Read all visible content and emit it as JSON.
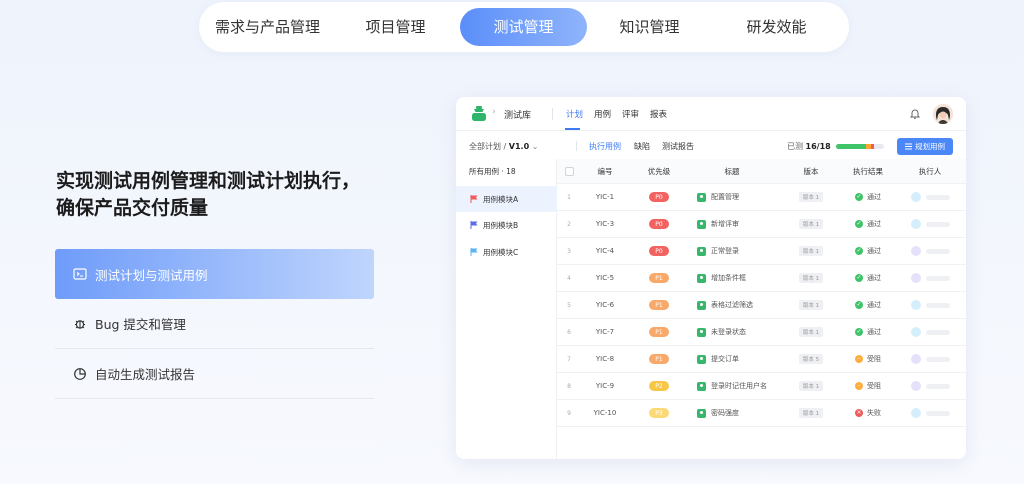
{
  "topnav": {
    "tabs": [
      {
        "label": "需求与产品管理",
        "active": false
      },
      {
        "label": "项目管理",
        "active": false
      },
      {
        "label": "测试管理",
        "active": true
      },
      {
        "label": "知识管理",
        "active": false
      },
      {
        "label": "研发效能",
        "active": false
      }
    ]
  },
  "hero": {
    "line1": "实现测试用例管理和测试计划执行，",
    "line2": "确保产品交付质量"
  },
  "features": [
    {
      "label": "测试计划与测试用例",
      "icon": "terminal-icon",
      "active": true
    },
    {
      "label": "Bug 提交和管理",
      "icon": "bug-icon",
      "active": false
    },
    {
      "label": "自动生成测试报告",
      "icon": "pie-chart-icon",
      "active": false
    }
  ],
  "app": {
    "name": "测试库",
    "tabs": [
      "计划",
      "用例",
      "评审",
      "报表"
    ],
    "active_tab": "计划",
    "plan_selector_prefix": "全部计划 / ",
    "plan_version": "V1.0",
    "subtabs": [
      "执行用例",
      "缺陷",
      "测试报告"
    ],
    "progress_label": "已测 ",
    "progress_value": "16/18",
    "progress": {
      "pass": 0.62,
      "block": 0.1,
      "fail": 0.07
    },
    "plan_button": "规划用例",
    "tree": {
      "header": "所有用例 · 18",
      "items": [
        {
          "label": "用例模块A",
          "color": "#ef5a5a",
          "active": true
        },
        {
          "label": "用例模块B",
          "color": "#5b6ee8",
          "active": false
        },
        {
          "label": "用例模块C",
          "color": "#58b4f0",
          "active": false
        }
      ]
    },
    "columns": [
      "编号",
      "优先级",
      "标题",
      "版本",
      "执行结果",
      "执行人"
    ],
    "rows": [
      {
        "num": "1",
        "id": "YIC-1",
        "prio": "P0",
        "title": "配置管理",
        "ver": "版本 1",
        "result": "通过",
        "status": "pass",
        "exec_color": "#d4eefc"
      },
      {
        "num": "2",
        "id": "YIC-3",
        "prio": "P0",
        "title": "新增评审",
        "ver": "版本 1",
        "result": "通过",
        "status": "pass",
        "exec_color": "#d4eefc"
      },
      {
        "num": "3",
        "id": "YIC-4",
        "prio": "P0",
        "title": "正常登录",
        "ver": "版本 1",
        "result": "通过",
        "status": "pass",
        "exec_color": "#e6e1fb"
      },
      {
        "num": "4",
        "id": "YIC-5",
        "prio": "P1",
        "title": "增加条件框",
        "ver": "版本 1",
        "result": "通过",
        "status": "pass",
        "exec_color": "#e6e1fb"
      },
      {
        "num": "5",
        "id": "YIC-6",
        "prio": "P1",
        "title": "表格过滤筛选",
        "ver": "版本 1",
        "result": "通过",
        "status": "pass",
        "exec_color": "#d4eefc"
      },
      {
        "num": "6",
        "id": "YIC-7",
        "prio": "P1",
        "title": "未登录状态",
        "ver": "版本 1",
        "result": "通过",
        "status": "pass",
        "exec_color": "#d4eefc"
      },
      {
        "num": "7",
        "id": "YIC-8",
        "prio": "P1",
        "title": "提交订单",
        "ver": "版本 5",
        "result": "受阻",
        "status": "block",
        "exec_color": "#e6e1fb"
      },
      {
        "num": "8",
        "id": "YIC-9",
        "prio": "P2",
        "title": "登录时记住用户名",
        "ver": "版本 1",
        "result": "受阻",
        "status": "block",
        "exec_color": "#e6e1fb"
      },
      {
        "num": "9",
        "id": "YIC-10",
        "prio": "P3",
        "title": "密码强度",
        "ver": "版本 1",
        "result": "失败",
        "status": "fail",
        "exec_color": "#d4eefc"
      }
    ],
    "colors": {
      "accent": "#3e7cf5",
      "P0": "#f2625f",
      "P1": "#f8a868",
      "P2": "#f8c747",
      "P3": "#fbd977",
      "pass": "#3fc46a",
      "block": "#ffae3d",
      "fail": "#ef5a5a"
    }
  }
}
